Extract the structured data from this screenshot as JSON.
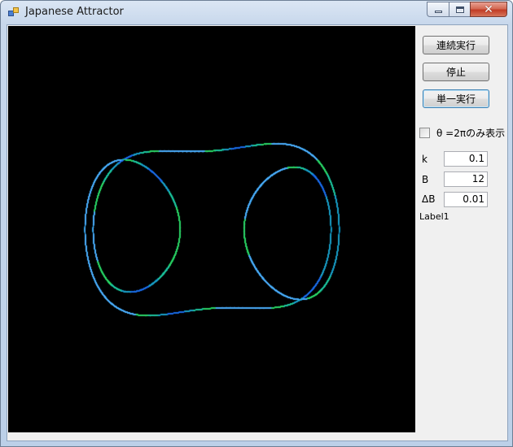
{
  "window": {
    "title": "Japanese Attractor",
    "minimize_glyph": "minimize-icon",
    "maximize_glyph": "maximize-icon",
    "close_glyph": "✕"
  },
  "controls": {
    "continuous_run_label": "連続実行",
    "stop_label": "停止",
    "single_run_label": "単一実行",
    "theta_checkbox_label": "θ =2πのみ表示",
    "theta_checked": false,
    "k_label": "k",
    "k_value": "0.1",
    "b_label": "B",
    "b_value": "12",
    "delta_b_label": "ΔB",
    "delta_b_value": "0.01",
    "status_label": "Label1"
  },
  "plot": {
    "background": "#000000",
    "colors": [
      "#1f6fe8",
      "#1ea0c8",
      "#22c6a0",
      "#2fd66a",
      "#4fb0ff"
    ],
    "attractor": "Duffing / Ueda (Japanese) attractor",
    "k": 0.1,
    "B": 12
  }
}
